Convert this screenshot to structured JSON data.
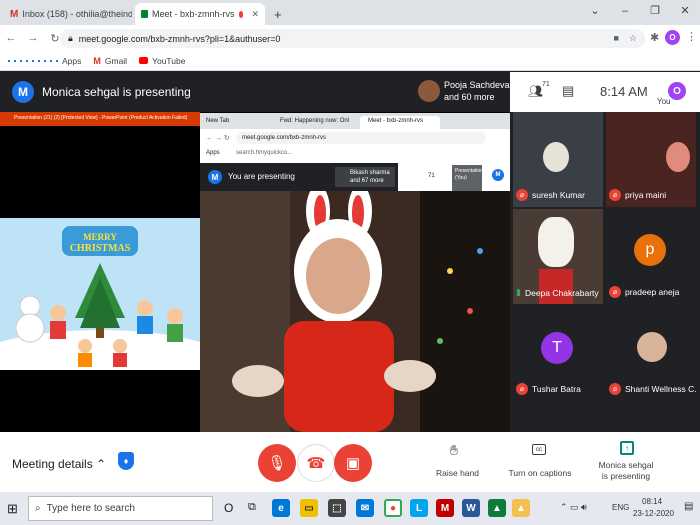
{
  "tabs": [
    {
      "label": "Inbox (158) - othilia@theindiansi",
      "icon": "gmail-icon"
    },
    {
      "label": "Meet - bxb-zmnh-rvs",
      "icon": "meet-icon"
    }
  ],
  "new_tab": "+",
  "address": {
    "url": "meet.google.com/bxb-zmnh-rvs?pli=1&authuser=0"
  },
  "bookmarks": [
    "Apps",
    "Gmail",
    "YouTube"
  ],
  "presenting_text": "Monica sehgal is presenting",
  "presenter_initial": "M",
  "pinned": {
    "name": "Pooja Sachdeva",
    "more": "and 60 more"
  },
  "people_count": "71",
  "time": "8:14 AM",
  "you": "You",
  "you_initial": "O",
  "ppt_title": "Presentation (21) (2) [Protected View] - PowerPoint (Product Activation Failed)",
  "slide_text": "MERRY CHRISTMAS",
  "inner": {
    "tabs": [
      "New Tab",
      "Fwd: Happening now: Onl",
      "Meet - bxb-zmnh-rvs"
    ],
    "url": "meet.google.com/bxb-zmnh-rvs",
    "apps": "Apps",
    "search": "search.hmyquickco...",
    "you_presenting": "You are presenting",
    "pinned_name": "Bikash sharma",
    "pinned_more": "and 67 more",
    "count": "71",
    "pres_label": "Presentation (You)",
    "you": "You"
  },
  "participants": [
    {
      "name": "suresh Kumar",
      "type": "video"
    },
    {
      "name": "priya maini",
      "type": "video"
    },
    {
      "name": "Deepa Chakrabarty",
      "type": "video"
    },
    {
      "name": "pradeep aneja",
      "initial": "p",
      "color": "#e8710a"
    },
    {
      "name": "Tushar Batra",
      "initial": "T",
      "color": "#9334e6"
    },
    {
      "name": "Shanti Wellness C...",
      "type": "photo"
    }
  ],
  "bottom": {
    "meeting_details": "Meeting details",
    "raise_hand": "Raise hand",
    "captions": "Turn on captions",
    "presenting_line1": "Monica sehgal",
    "presenting_line2": "is presenting"
  },
  "taskbar": {
    "search_placeholder": "Type here to search",
    "lang": "ENG",
    "time": "08:14",
    "date": "23-12-2020"
  },
  "colors": {
    "red": "#ea4335",
    "blue": "#1a73e8",
    "green": "#00832d"
  }
}
